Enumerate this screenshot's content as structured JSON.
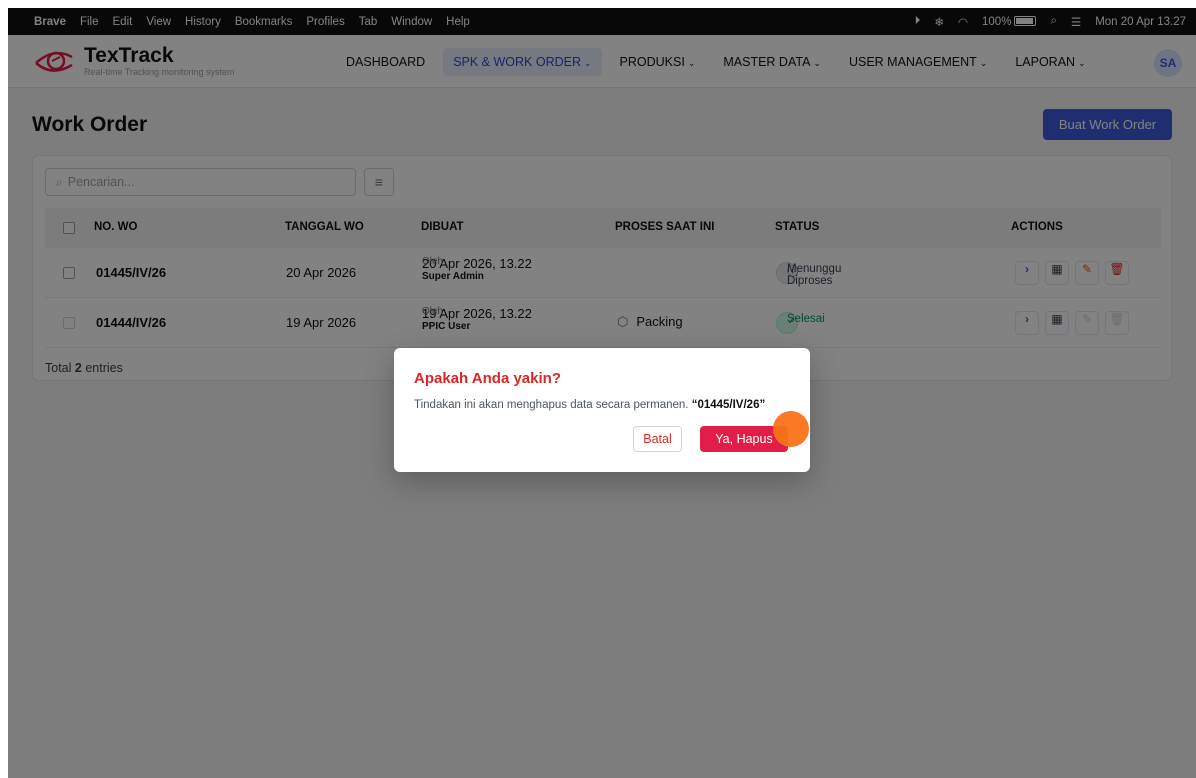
{
  "menubar": {
    "app": "Brave",
    "items": [
      "File",
      "Edit",
      "View",
      "History",
      "Bookmarks",
      "Profiles",
      "Tab",
      "Window",
      "Help"
    ],
    "battery": "100%",
    "clock": "Mon 20 Apr 13.27"
  },
  "app": {
    "name": "TexTrack",
    "tagline": "Real-time Tracking monitoring system",
    "nav": [
      {
        "label": "DASHBOARD",
        "chevron": ""
      },
      {
        "label": "SPK & WORK ORDER",
        "chevron": "⌄"
      },
      {
        "label": "PRODUKSI",
        "chevron": "⌄"
      },
      {
        "label": "MASTER DATA",
        "chevron": "⌄"
      },
      {
        "label": "USER MANAGEMENT",
        "chevron": "⌄"
      },
      {
        "label": "LAPORAN",
        "chevron": "⌄"
      }
    ],
    "avatar": "SA",
    "accent": "#3b5bdb"
  },
  "page": {
    "title": "Work Order",
    "create_button": "Buat Work Order",
    "search_placeholder": "Pencarian...",
    "columns": [
      "NO. WO",
      "TANGGAL WO",
      "DIBUAT",
      "PROSES SAAT INI",
      "STATUS",
      "ACTIONS"
    ],
    "rows": [
      {
        "no": "01445/IV/26",
        "date": "20 Apr 2026",
        "created": "20 Apr 2026, 13.22",
        "by_prefix": "Oleh",
        "by": "Super Admin",
        "process": "",
        "status": "Menunggu Diproses"
      },
      {
        "no": "01444/IV/26",
        "date": "19 Apr 2026",
        "created": "19 Apr 2026, 13.22",
        "by_prefix": "Oleh",
        "by": "PPIC User",
        "process": "Packing",
        "status": "Selesai"
      }
    ],
    "total_prefix": "Total",
    "total_count": "2",
    "total_suffix": "entries"
  },
  "dialog": {
    "title": "Apakah Anda yakin?",
    "message": "Tindakan ini akan menghapus data secara permanen.",
    "target": "“01445/IV/26”",
    "cancel": "Batal",
    "confirm": "Ya, Hapus"
  }
}
